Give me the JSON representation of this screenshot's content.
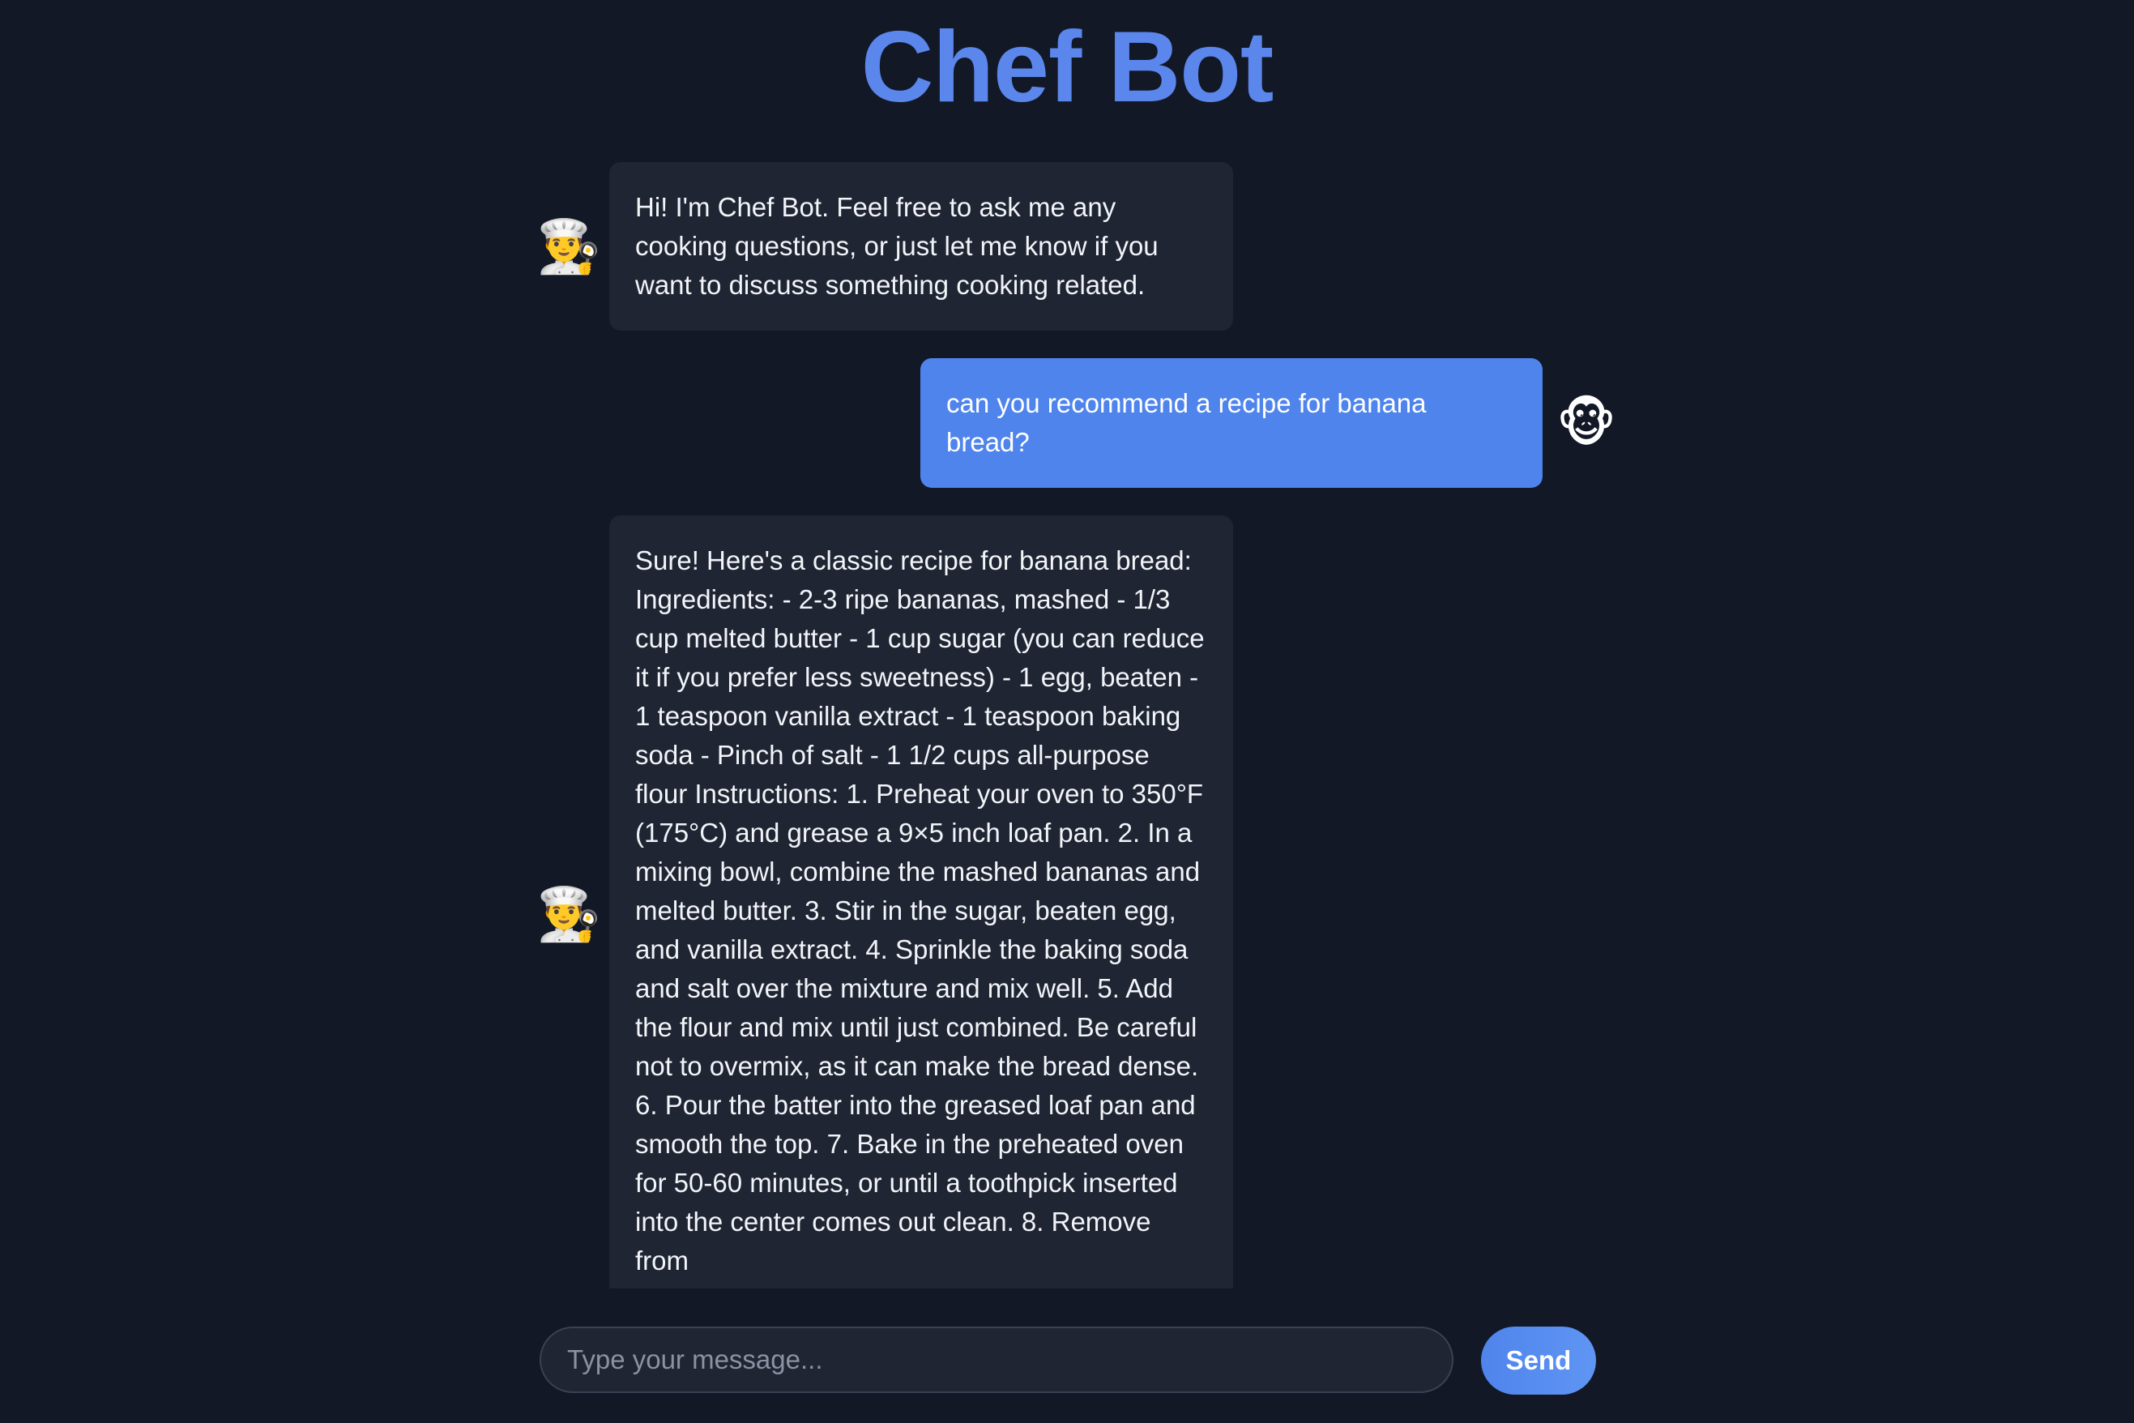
{
  "header": {
    "title": "Chef Bot"
  },
  "messages": [
    {
      "role": "bot",
      "avatar": "👨‍🍳",
      "avatar_icon": "chef-icon",
      "text": "Hi! I'm Chef Bot. Feel free to ask me any cooking questions, or just let me know if you want to discuss something cooking related."
    },
    {
      "role": "user",
      "avatar": "🐵",
      "avatar_icon": "monkey-icon",
      "text": "can you recommend a recipe for banana bread?"
    },
    {
      "role": "bot",
      "avatar": "👨‍🍳",
      "avatar_icon": "chef-icon",
      "text": "Sure! Here's a classic recipe for banana bread: Ingredients: - 2-3 ripe bananas, mashed - 1/3 cup melted butter - 1 cup sugar (you can reduce it if you prefer less sweetness) - 1 egg, beaten - 1 teaspoon vanilla extract - 1 teaspoon baking soda - Pinch of salt - 1 1/2 cups all-purpose flour Instructions: 1. Preheat your oven to 350°F (175°C) and grease a 9×5 inch loaf pan. 2. In a mixing bowl, combine the mashed bananas and melted butter. 3. Stir in the sugar, beaten egg, and vanilla extract. 4. Sprinkle the baking soda and salt over the mixture and mix well. 5. Add the flour and mix until just combined. Be careful not to overmix, as it can make the bread dense. 6. Pour the batter into the greased loaf pan and smooth the top. 7. Bake in the preheated oven for 50-60 minutes, or until a toothpick inserted into the center comes out clean. 8. Remove from"
    }
  ],
  "composer": {
    "placeholder": "Type your message...",
    "value": "",
    "send_label": "Send"
  },
  "colors": {
    "background": "#121826",
    "accent": "#5b86ec",
    "bot_bubble": "#1f2533",
    "user_bubble": "#4f84ec"
  }
}
